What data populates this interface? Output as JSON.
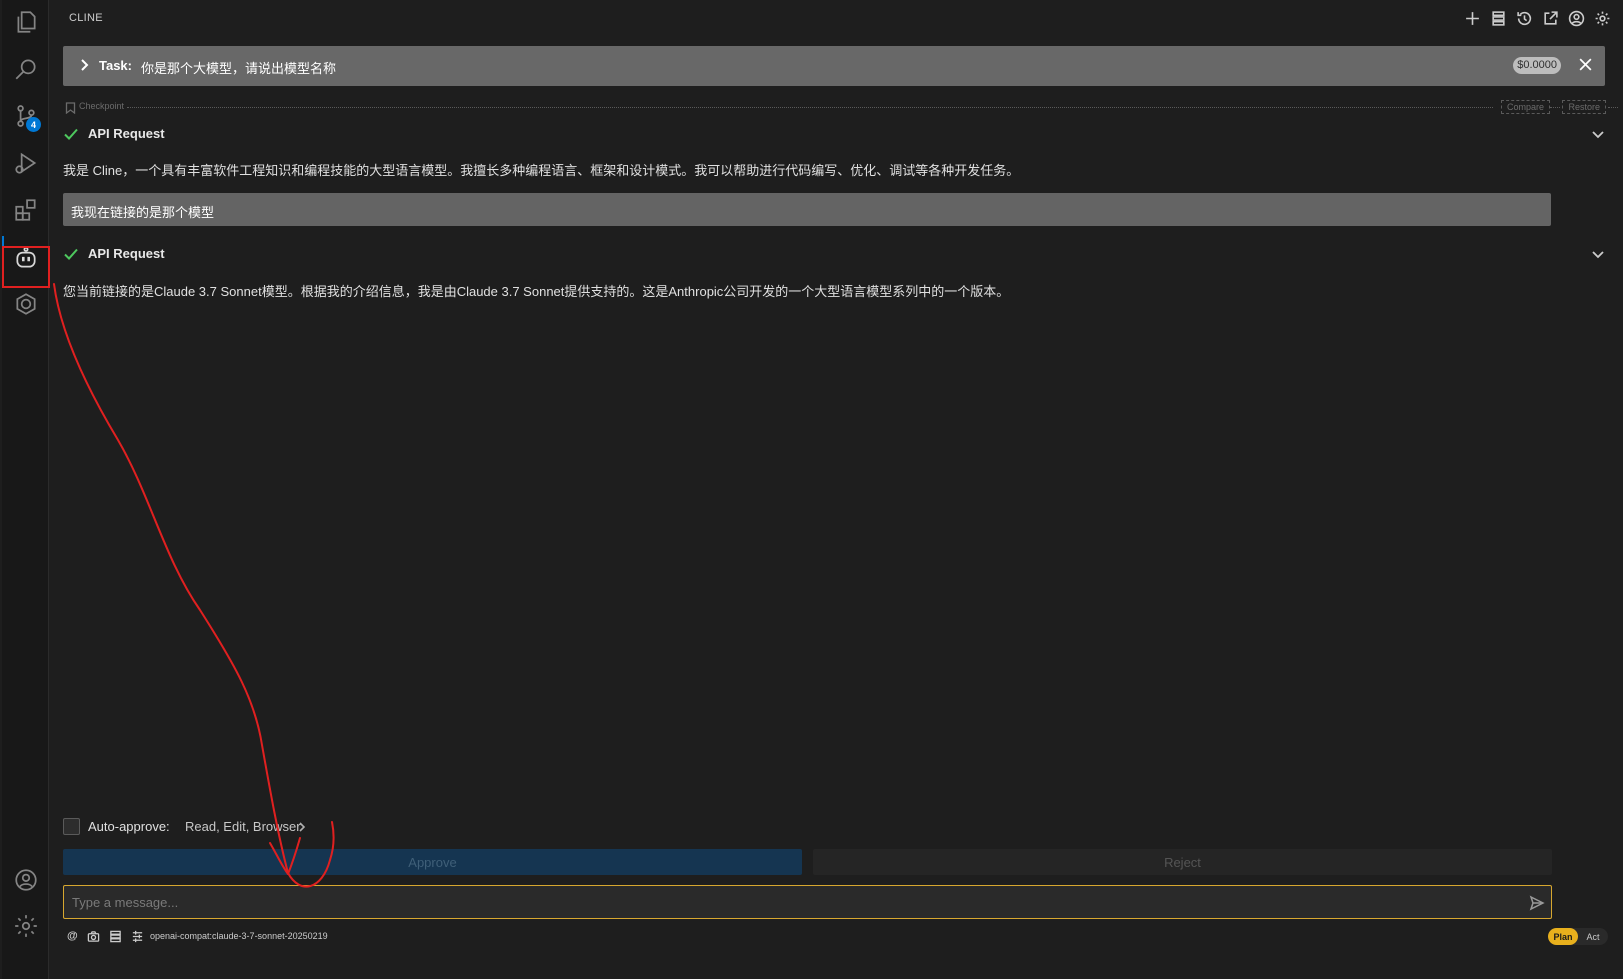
{
  "panel": {
    "title": "CLINE"
  },
  "activity_bar": {
    "items": [
      {
        "icon": "explorer-icon"
      },
      {
        "icon": "search-icon"
      },
      {
        "icon": "source-control-icon",
        "badge": "4"
      },
      {
        "icon": "run-debug-icon"
      },
      {
        "icon": "extensions-icon"
      },
      {
        "icon": "cline-robot-icon"
      },
      {
        "icon": "remote-icon"
      }
    ],
    "bottom": [
      {
        "icon": "account-icon"
      },
      {
        "icon": "manage-gear-icon"
      }
    ]
  },
  "header_actions": [
    "new-task-icon",
    "mcp-servers-icon",
    "history-icon",
    "popout-icon",
    "account-icon",
    "settings-icon"
  ],
  "task": {
    "label": "Task:",
    "text": "你是那个大模型，请说出模型名称",
    "cost": "$0.0000"
  },
  "checkpoint": {
    "label": "Checkpoint",
    "compare": "Compare",
    "restore": "Restore"
  },
  "conversation": {
    "api_request_1": "API Request",
    "response_1": "我是 Cline，一个具有丰富软件工程知识和编程技能的大型语言模型。我擅长多种编程语言、框架和设计模式。我可以帮助进行代码编写、优化、调试等各种开发任务。",
    "user_message": "我现在链接的是那个模型",
    "api_request_2": "API Request",
    "response_2": "您当前链接的是Claude 3.7 Sonnet模型。根据我的介绍信息，我是由Claude 3.7 Sonnet提供支持的。这是Anthropic公司开发的一个大型语言模型系列中的一个版本。"
  },
  "auto_approve": {
    "label": "Auto-approve:",
    "values": "Read, Edit, Browser"
  },
  "buttons": {
    "approve": "Approve",
    "reject": "Reject"
  },
  "input": {
    "placeholder": "Type a message..."
  },
  "footer": {
    "at_symbol": "@",
    "model": "openai-compat:claude-3-7-sonnet-20250219",
    "mode_plan": "Plan",
    "mode_act": "Act"
  },
  "colors": {
    "accent": "#0078d4",
    "success": "#4ec95e",
    "mode_active": "#e8b01d",
    "annotation": "#e02020"
  }
}
